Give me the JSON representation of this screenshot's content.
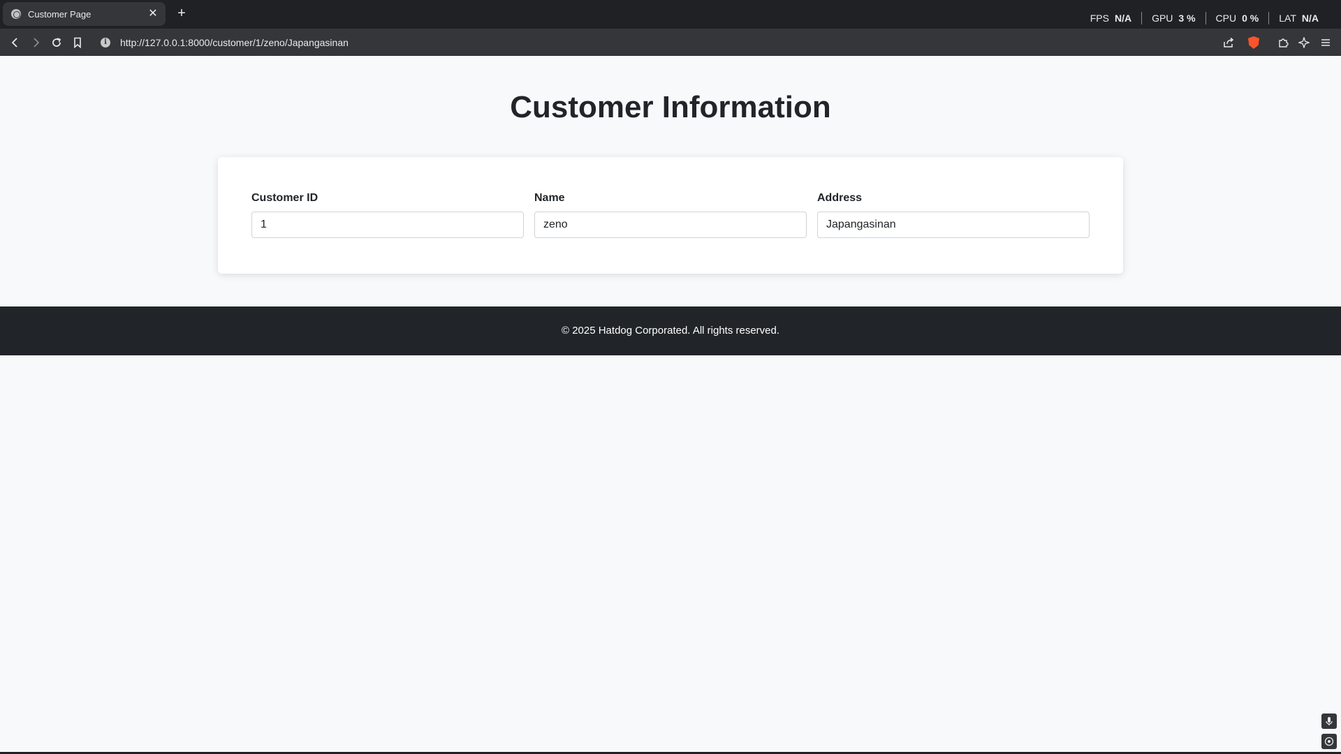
{
  "browser": {
    "tab_title": "Customer Page",
    "tab_close": "✕",
    "new_tab": "+",
    "url": "http://127.0.0.1:8000/customer/1/zeno/Japangasinan",
    "info_glyph": "i"
  },
  "perf": [
    {
      "label": "FPS",
      "value": "N/A"
    },
    {
      "label": "GPU",
      "value": "3 %"
    },
    {
      "label": "CPU",
      "value": "0 %"
    },
    {
      "label": "LAT",
      "value": "N/A"
    }
  ],
  "page": {
    "title": "Customer Information",
    "fields": [
      {
        "label": "Customer ID",
        "value": "1"
      },
      {
        "label": "Name",
        "value": "zeno"
      },
      {
        "label": "Address",
        "value": "Japangasinan"
      }
    ],
    "footer": "© 2025 Hatdog Corporated. All rights reserved."
  },
  "icons": {
    "back": "back-icon",
    "forward": "forward-icon",
    "reload": "reload-icon",
    "bookmark": "bookmark-icon",
    "share": "share-icon",
    "brave": "brave-shield-icon",
    "extensions": "extensions-icon",
    "leo": "ai-sparkle-icon",
    "menu": "menu-icon",
    "mic": "microphone-icon",
    "target": "target-icon"
  }
}
